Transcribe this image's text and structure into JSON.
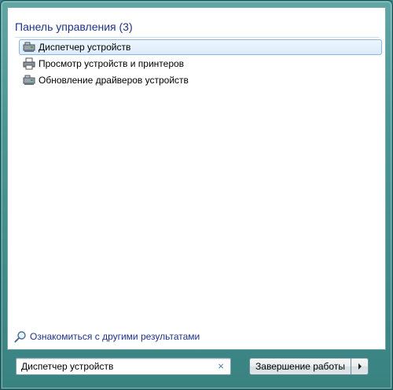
{
  "group": {
    "title": "Панель управления (3)"
  },
  "results": [
    {
      "label": "Диспетчер устройств",
      "icon": "device-manager-icon",
      "selected": true
    },
    {
      "label": "Просмотр устройств и принтеров",
      "icon": "printer-icon",
      "selected": false
    },
    {
      "label": "Обновление драйверов устройств",
      "icon": "device-manager-icon",
      "selected": false
    }
  ],
  "more_results": {
    "label": "Ознакомиться с другими результатами",
    "icon": "magnifier-icon"
  },
  "search": {
    "value": "Диспетчер устройств",
    "clear_glyph": "×"
  },
  "shutdown": {
    "label": "Завершение работы",
    "arrow_icon": "triangle-right-icon"
  },
  "colors": {
    "accent_text": "#1e3287",
    "selection_border": "#86b6ea",
    "frame_glass": "#4a9896"
  }
}
